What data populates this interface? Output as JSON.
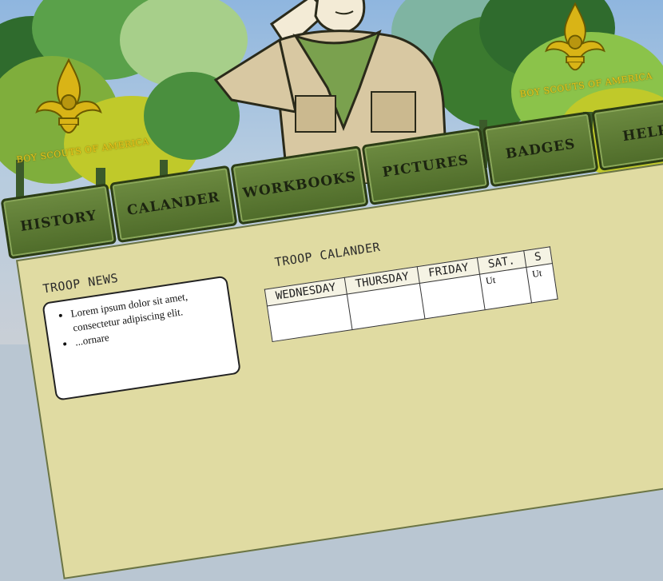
{
  "header": {
    "emblem_left_text": "BOY SCOUTS OF AMERICA",
    "emblem_right_text": "BOY SCOUTS OF AMERICA"
  },
  "nav": {
    "tabs": [
      {
        "label": "HISTORY"
      },
      {
        "label": "CALANDER"
      },
      {
        "label": "WORKBOOKS"
      },
      {
        "label": "PICTURES"
      },
      {
        "label": "BADGES"
      },
      {
        "label": "HELP"
      }
    ]
  },
  "news": {
    "title": "TROOP NEWS",
    "items": [
      "Lorem ipsum dolor sit amet, consectetur adipiscing elit.",
      "...ornare"
    ]
  },
  "calendar": {
    "title": "TROOP CALANDER",
    "headers": [
      "WEDNESDAY",
      "THURSDAY",
      "FRIDAY",
      "SAT.",
      "S"
    ],
    "cells": [
      "",
      "",
      "",
      "Ut",
      "Ut"
    ]
  },
  "colors": {
    "tab_green": "#5f7d35",
    "content_bg": "#e0dba2",
    "emblem_gold": "#e8c31a"
  }
}
